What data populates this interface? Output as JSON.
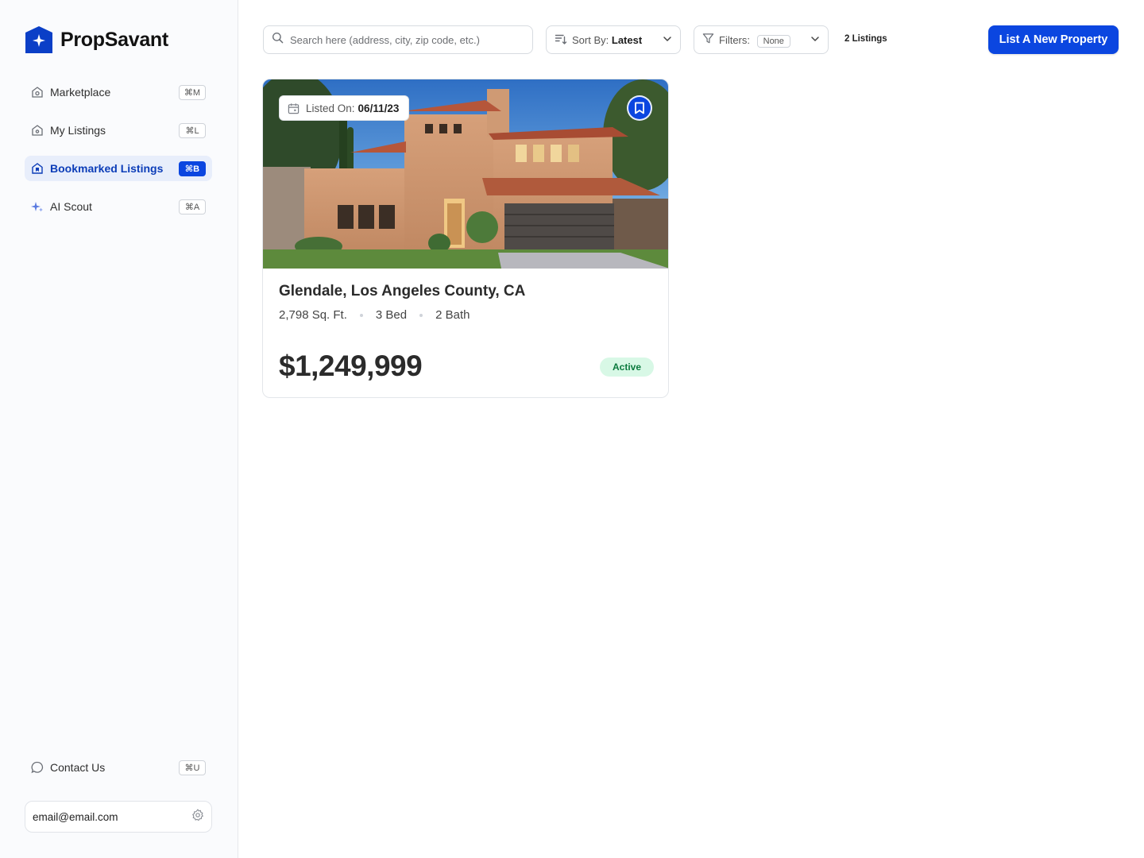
{
  "brand": {
    "name": "PropSavant",
    "accent": "#0b46e0"
  },
  "sidebar": {
    "items": [
      {
        "label": "Marketplace",
        "shortcut": "⌘M",
        "icon": "home-icon"
      },
      {
        "label": "My Listings",
        "shortcut": "⌘L",
        "icon": "home-icon"
      },
      {
        "label": "Bookmarked Listings",
        "shortcut": "⌘B",
        "icon": "bookmark-home-icon",
        "active": true
      },
      {
        "label": "AI Scout",
        "shortcut": "⌘A",
        "icon": "sparkle-icon"
      }
    ],
    "contact": {
      "label": "Contact Us",
      "shortcut": "⌘U",
      "icon": "chat-icon"
    },
    "account": {
      "email": "email@email.com",
      "icon": "gear-icon"
    }
  },
  "toolbar": {
    "search_placeholder": "Search here (address, city, zip code, etc.)",
    "sort_label": "Sort By:",
    "sort_value": "Latest",
    "filters_label": "Filters:",
    "filters_value": "None",
    "listing_count": "2 Listings",
    "cta_label": "List A New Property"
  },
  "listings": [
    {
      "listed_label": "Listed On:",
      "listed_date": "06/11/23",
      "location": "Glendale, Los Angeles County, CA",
      "sqft": "2,798 Sq. Ft.",
      "beds": "3 Bed",
      "baths": "2 Bath",
      "price": "$1,249,999",
      "status": "Active",
      "bookmarked": true
    }
  ]
}
